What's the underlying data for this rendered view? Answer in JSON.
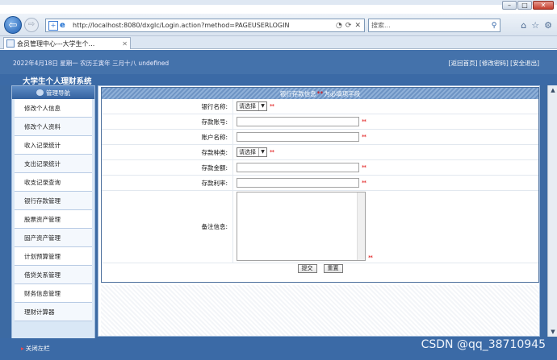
{
  "browser": {
    "url": "http://localhost:8080/dxglc/Login.action?method=PAGEUSERLOGIN",
    "search_placeholder": "搜索...",
    "tab_title": "会员管理中心---大学生个...",
    "back_icon": "arrow-left-icon",
    "forward_icon": "arrow-right-icon"
  },
  "header": {
    "date_text": "2022年4月18日 星期一 农历壬寅年 三月十八 undefined",
    "links_text": "[返回首页] [修改密码] [安全退出]",
    "system_title": "大学生个人理财系统"
  },
  "sidebar": {
    "heading": "管理导航",
    "items": [
      {
        "label": "修改个人信息"
      },
      {
        "label": "修改个人资料"
      },
      {
        "label": "收入记录统计"
      },
      {
        "label": "支出记录统计"
      },
      {
        "label": "收支记录查询"
      },
      {
        "label": "银行存款管理"
      },
      {
        "label": "股票资产管理"
      },
      {
        "label": "固产资产管理"
      },
      {
        "label": "计划预算管理"
      },
      {
        "label": "借贷关系管理"
      },
      {
        "label": "财务信息管理"
      },
      {
        "label": "理财计算器"
      }
    ]
  },
  "form": {
    "header_text_before": "银行存款信息",
    "header_required_marks": "**",
    "header_text_after": "为必填项字段",
    "rows": [
      {
        "label": "银行名称:",
        "type": "select",
        "value": "请选择",
        "required": "**"
      },
      {
        "label": "存款账号:",
        "type": "input",
        "value": "",
        "required": "**"
      },
      {
        "label": "账户名称:",
        "type": "input",
        "value": "",
        "required": "**"
      },
      {
        "label": "存款种类:",
        "type": "select",
        "value": "请选择",
        "required": "**"
      },
      {
        "label": "存款金额:",
        "type": "input",
        "value": "",
        "required": "**"
      },
      {
        "label": "存款利率:",
        "type": "input",
        "value": "",
        "required": "**"
      },
      {
        "label": "备注信息:",
        "type": "textarea",
        "value": "",
        "required": "**"
      }
    ],
    "submit_label": "提交",
    "reset_label": "重置"
  },
  "footer": {
    "close_left_label": "关闭左栏",
    "watermark": "CSDN @qq_38710945"
  }
}
